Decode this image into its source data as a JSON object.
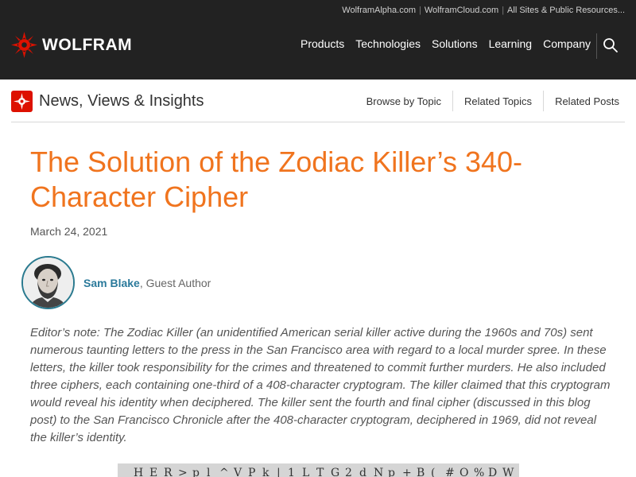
{
  "header": {
    "util_links": [
      "WolframAlpha.com",
      "WolframCloud.com",
      "All Sites & Public Resources..."
    ],
    "logo_text": "WOLFRAM",
    "nav": [
      "Products",
      "Technologies",
      "Solutions",
      "Learning",
      "Company"
    ]
  },
  "subheader": {
    "title": "News, Views & Insights",
    "nav": [
      "Browse by Topic",
      "Related Topics",
      "Related Posts"
    ]
  },
  "article": {
    "title": "The Solution of the Zodiac Killer’s 340-Character Cipher",
    "date": "March 24, 2021",
    "author_name": "Sam Blake",
    "author_role": ", Guest Author",
    "editor_note": "Editor’s note: The Zodiac Killer (an unidentified American serial killer active during the 1960s and 70s) sent numerous taunting letters to the press in the San Francisco area with regard to a local murder spree. In these letters, the killer took responsibility for the crimes and threatened to commit further murders. He also included three ciphers, each containing one-third of a 408-character cryptogram. The killer claimed that this cryptogram would reveal his identity when deciphered. The killer sent the fourth and final cipher (discussed in this blog post) to the San Francisco Chronicle after the 408-character cryptogram, deciphered in 1969, did not reveal the killer’s identity."
  },
  "colors": {
    "brand_red": "#dd1100",
    "title_orange": "#f0741e",
    "author_blue": "#2b7a9b",
    "header_bg": "#222222"
  },
  "icons": [
    "wolfram-spikey-logo-icon",
    "search-icon",
    "spikey-small-icon"
  ]
}
